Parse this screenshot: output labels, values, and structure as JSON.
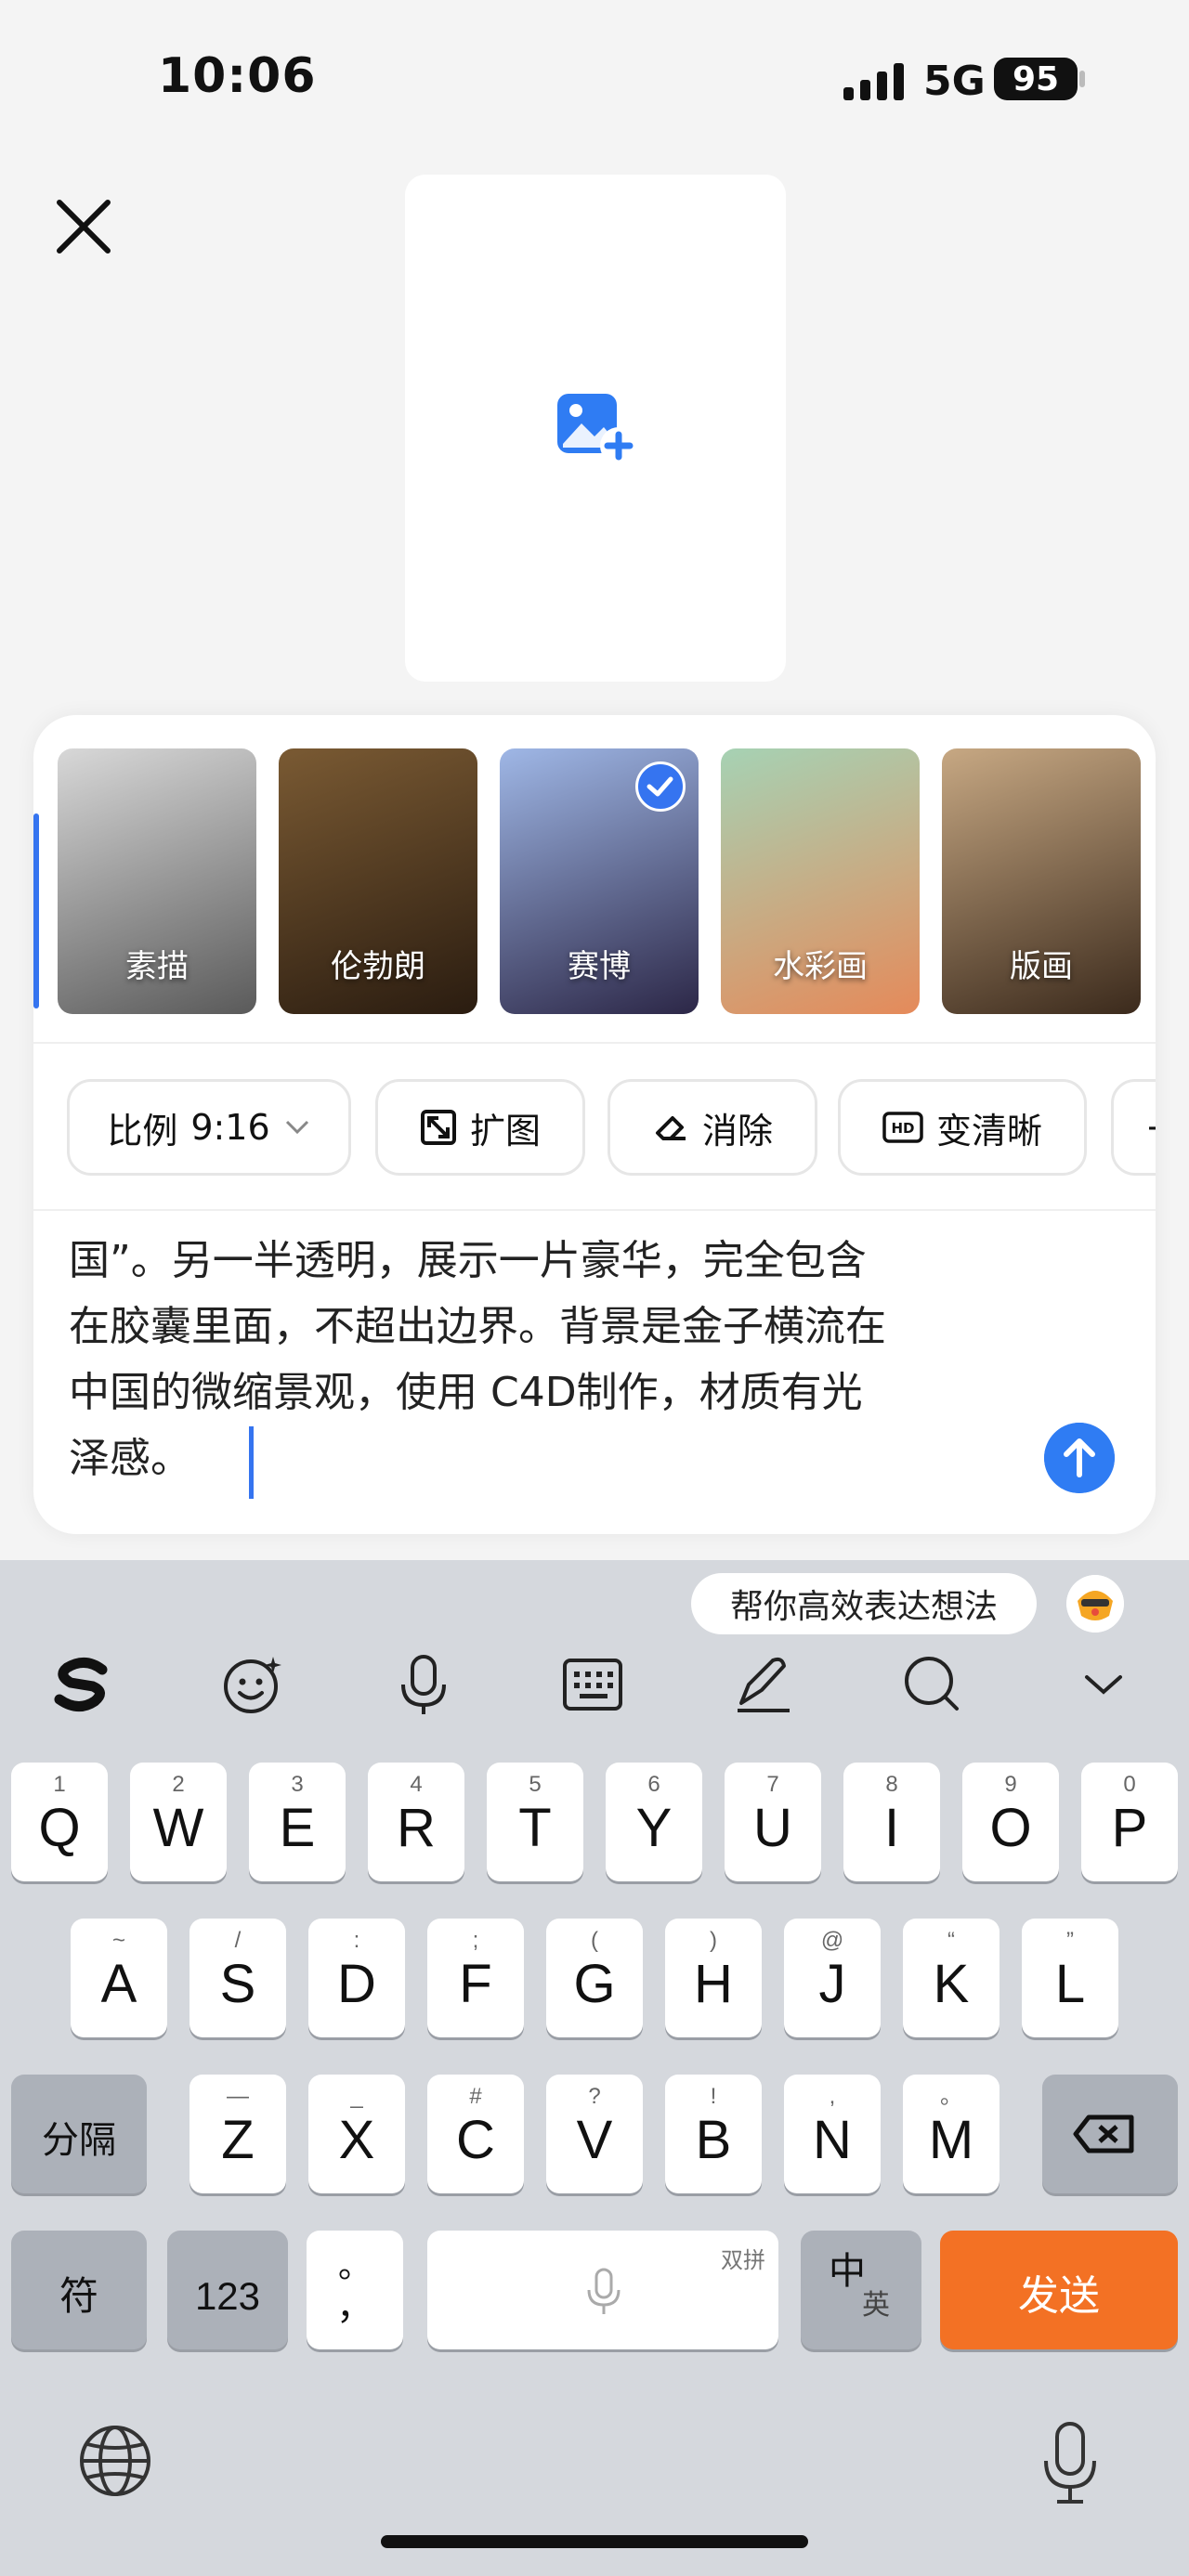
{
  "status_bar": {
    "time": "10:06",
    "network": "5G",
    "battery": "95"
  },
  "upload": {
    "icon": "image-add-icon"
  },
  "styles": [
    {
      "label": "素描",
      "colors": [
        "#d8d8d8",
        "#5a5a5a"
      ],
      "selected": false
    },
    {
      "label": "伦勃朗",
      "colors": [
        "#7a5a33",
        "#2a1c10"
      ],
      "selected": false
    },
    {
      "label": "赛博",
      "colors": [
        "#9fb7e6",
        "#2c2747"
      ],
      "selected": true
    },
    {
      "label": "水彩画",
      "colors": [
        "#a6d2b4",
        "#e58a5a"
      ],
      "selected": false
    },
    {
      "label": "版画",
      "colors": [
        "#c7a883",
        "#3b2a1c"
      ],
      "selected": false
    }
  ],
  "tools": {
    "ratio": {
      "label": "比例",
      "value": "9:16"
    },
    "expand": "扩图",
    "erase": "消除",
    "enhance": "变清晰",
    "more": "+"
  },
  "prompt": {
    "lines": [
      "国”。另一半透明，展示一片豪华，完全包含",
      "在胶囊里面，不超出边界。背景是金子横流在",
      "中国的微缩景观，使用 C4D制作，材质有光",
      "泽感。"
    ]
  },
  "keyboard": {
    "suggestion": "帮你高效表达想法",
    "row1": [
      {
        "main": "Q",
        "sub": "1"
      },
      {
        "main": "W",
        "sub": "2"
      },
      {
        "main": "E",
        "sub": "3"
      },
      {
        "main": "R",
        "sub": "4"
      },
      {
        "main": "T",
        "sub": "5"
      },
      {
        "main": "Y",
        "sub": "6"
      },
      {
        "main": "U",
        "sub": "7"
      },
      {
        "main": "I",
        "sub": "8"
      },
      {
        "main": "O",
        "sub": "9"
      },
      {
        "main": "P",
        "sub": "0"
      }
    ],
    "row2": [
      {
        "main": "A",
        "sub": "~"
      },
      {
        "main": "S",
        "sub": "/"
      },
      {
        "main": "D",
        "sub": ":"
      },
      {
        "main": "F",
        "sub": ";"
      },
      {
        "main": "G",
        "sub": "("
      },
      {
        "main": "H",
        "sub": ")"
      },
      {
        "main": "J",
        "sub": "@"
      },
      {
        "main": "K",
        "sub": "“"
      },
      {
        "main": "L",
        "sub": "”"
      }
    ],
    "row3": [
      {
        "main": "Z",
        "sub": "—"
      },
      {
        "main": "X",
        "sub": "_"
      },
      {
        "main": "C",
        "sub": "#"
      },
      {
        "main": "V",
        "sub": "?"
      },
      {
        "main": "B",
        "sub": "!"
      },
      {
        "main": "N",
        "sub": ","
      },
      {
        "main": "M",
        "sub": "。"
      }
    ],
    "separator": "分隔",
    "symbols": "符",
    "numbers": "123",
    "punct_top": "。",
    "punct_bottom": "，",
    "space_hint": "双拼",
    "lang_zh": "中",
    "lang_en": "英",
    "send": "发送"
  }
}
